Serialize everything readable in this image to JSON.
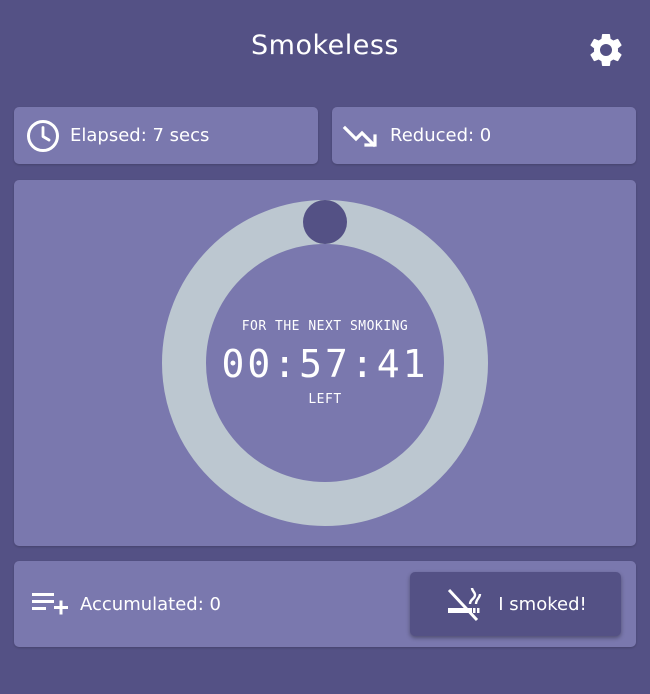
{
  "app": {
    "title": "Smokeless"
  },
  "icons": {
    "settings": "gear-icon",
    "elapsed": "clock-icon",
    "reduced": "trending-down-icon",
    "accumulated": "playlist-add-icon",
    "smoked": "smoking-icon"
  },
  "stats": {
    "elapsed_label": "Elapsed: 7 secs",
    "reduced_label": "Reduced: 0"
  },
  "timer": {
    "caption": "FOR THE NEXT SMOKING",
    "time": "00:57:41",
    "suffix": "LEFT",
    "progress_fraction": 0.0
  },
  "bottom": {
    "accumulated_label": "Accumulated: 0",
    "smoked_button_label": "I smoked!"
  },
  "colors": {
    "background": "#545185",
    "card": "#7a78ae",
    "ring_track": "#bcc7d0",
    "ring_knob": "#545185"
  }
}
